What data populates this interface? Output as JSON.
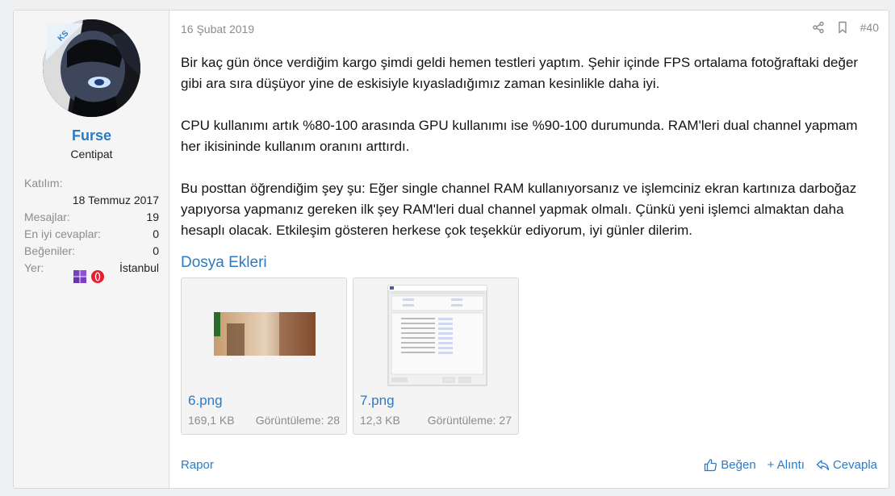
{
  "user": {
    "name": "Furse",
    "title": "Centipat",
    "badge": "KS",
    "joined_label": "Katılım:",
    "joined_value": "18 Temmuz 2017",
    "stats": [
      {
        "label": "Mesajlar:",
        "value": "19"
      },
      {
        "label": "En iyi cevaplar:",
        "value": "0"
      },
      {
        "label": "Beğeniler:",
        "value": "0"
      },
      {
        "label": "Yer:",
        "value": "İstanbul"
      }
    ],
    "icons": [
      "windows-icon",
      "opera-icon"
    ]
  },
  "post": {
    "date": "16 Şubat 2019",
    "number": "#40",
    "paragraphs": [
      "Bir kaç gün önce verdiğim kargo şimdi geldi hemen testleri yaptım. Şehir içinde FPS ortalama fotoğraftaki değer gibi ara sıra düşüyor yine de eskisiyle kıyasladığımız zaman kesinlikle daha iyi.",
      "CPU kullanımı artık %80-100 arasında GPU kullanımı ise %90-100 durumunda. RAM'leri dual channel yapmam her ikisininde kullanım oranını arttırdı.",
      "Bu posttan öğrendiğim şey şu: Eğer single channel RAM kullanıyorsanız ve işlemciniz ekran kartınıza darboğaz yapıyorsa yapmanız gereken ilk şey RAM'leri dual channel yapmak olmalı. Çünkü yeni işlemci almaktan daha hesaplı olacak. Etkileşim gösteren herkese çok teşekkür ediyorum, iyi günler dilerim."
    ]
  },
  "attachments": {
    "title": "Dosya Ekleri",
    "items": [
      {
        "name": "6.png",
        "size": "169,1 KB",
        "views": "Görüntüleme: 28"
      },
      {
        "name": "7.png",
        "size": "12,3 KB",
        "views": "Görüntüleme: 27"
      }
    ]
  },
  "footer": {
    "report": "Rapor",
    "like": "Beğen",
    "quote": "+ Alıntı",
    "reply": "Cevapla"
  },
  "colors": {
    "link": "#2b7bc4",
    "muted": "#8c8c8c",
    "sidebar_bg": "#f5f5f5"
  }
}
